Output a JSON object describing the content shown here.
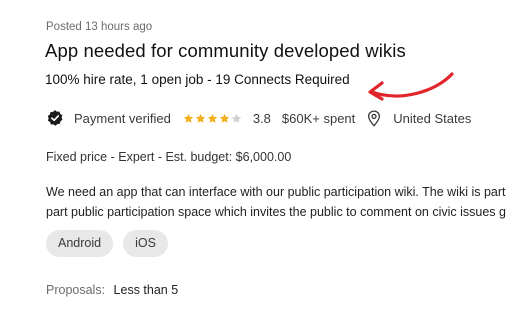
{
  "job": {
    "posted": "Posted 13 hours ago",
    "title": "App needed for community developed wikis",
    "meta_line": "100% hire rate, 1 open job - 19 Connects Required",
    "client": {
      "payment_status": "Payment verified",
      "rating_stars": 4,
      "rating_max": 5,
      "rating": "3.8",
      "spent": "$60K+ spent",
      "location": "United States"
    },
    "budget_line": "Fixed price - Expert - Est. budget: $6,000.00",
    "description_lines": [
      "We need an app that can interface with our public participation wiki. The wiki is part",
      "part public participation space which invites the public to comment on civic issues g"
    ],
    "skills": [
      "Android",
      "iOS"
    ],
    "proposals": {
      "label": "Proposals:",
      "value": "Less than 5"
    }
  },
  "colors": {
    "star_filled": "#f2b01e",
    "star_empty": "#d0d0d0",
    "arrow": "#e0262a",
    "tag_bg": "#e8e8e8"
  },
  "icons": [
    "verified-badge-icon",
    "star-icon",
    "location-pin-icon",
    "red-arrow-annotation"
  ]
}
